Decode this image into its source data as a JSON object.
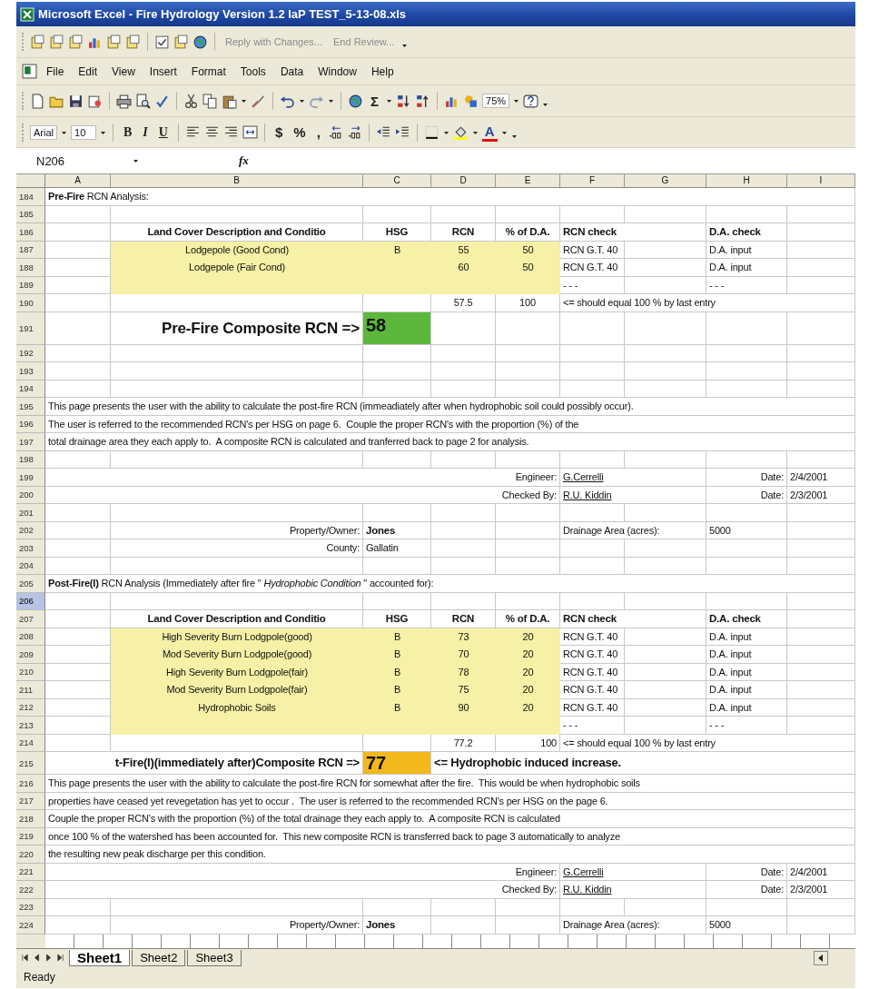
{
  "window": {
    "title": "Microsoft Excel - Fire Hydrology Version 1.2 IaP TEST_5-13-08.xls"
  },
  "review_toolbar": {
    "items": [
      {
        "kind": "review"
      },
      {
        "kind": "review"
      },
      {
        "kind": "review"
      },
      {
        "kind": "chart"
      },
      {
        "kind": "review"
      },
      {
        "kind": "review"
      },
      {
        "kind": "separator"
      },
      {
        "kind": "check"
      },
      {
        "kind": "review"
      },
      {
        "kind": "globe"
      },
      {
        "kind": "separator"
      }
    ],
    "reply": "Reply with Changes...",
    "end_review": "End Review..."
  },
  "menu": [
    {
      "label": "File"
    },
    {
      "label": "Edit"
    },
    {
      "label": "View"
    },
    {
      "label": "Insert"
    },
    {
      "label": "Format"
    },
    {
      "label": "Tools"
    },
    {
      "label": "Data"
    },
    {
      "label": "Window"
    },
    {
      "label": "Help"
    }
  ],
  "standard_toolbar": [
    {
      "kind": "document"
    },
    {
      "kind": "folder"
    },
    {
      "kind": "save"
    },
    {
      "kind": "permission"
    },
    {
      "kind": "separator"
    },
    {
      "kind": "print"
    },
    {
      "kind": "preview"
    },
    {
      "kind": "spell"
    },
    {
      "kind": "separator"
    },
    {
      "kind": "cut"
    },
    {
      "kind": "copy"
    },
    {
      "kind": "paste"
    },
    {
      "kind": "dropdown"
    },
    {
      "kind": "brush"
    },
    {
      "kind": "separator"
    },
    {
      "kind": "undo"
    },
    {
      "kind": "dropdown"
    },
    {
      "kind": "redo"
    },
    {
      "kind": "dropdown"
    },
    {
      "kind": "separator"
    },
    {
      "kind": "globe"
    },
    {
      "kind": "symbol",
      "label": "Σ"
    },
    {
      "kind": "dropdown"
    },
    {
      "kind": "sort-asc"
    },
    {
      "kind": "sort-desc"
    },
    {
      "kind": "separator"
    },
    {
      "kind": "chart"
    },
    {
      "kind": "drawing"
    },
    {
      "kind": "combo",
      "value": "75%"
    },
    {
      "kind": "help"
    },
    {
      "kind": "overflow"
    }
  ],
  "formatting_toolbar": [
    {
      "kind": "combo",
      "value": "Arial"
    },
    {
      "kind": "combo",
      "value": "10"
    },
    {
      "kind": "separator"
    },
    {
      "kind": "bold",
      "label": "B"
    },
    {
      "kind": "italic",
      "label": "I"
    },
    {
      "kind": "underline",
      "label": "U"
    },
    {
      "kind": "separator"
    },
    {
      "kind": "align-left"
    },
    {
      "kind": "align-center"
    },
    {
      "kind": "align-right"
    },
    {
      "kind": "merge"
    },
    {
      "kind": "separator"
    },
    {
      "kind": "symbol",
      "label": "$"
    },
    {
      "kind": "symbol",
      "label": "%"
    },
    {
      "kind": "symbol",
      "label": ","
    },
    {
      "kind": "decimal-more"
    },
    {
      "kind": "decimal-less"
    },
    {
      "kind": "separator"
    },
    {
      "kind": "indent-less"
    },
    {
      "kind": "indent-more"
    },
    {
      "kind": "separator"
    },
    {
      "kind": "borders"
    },
    {
      "kind": "dropdown"
    },
    {
      "kind": "fill-color"
    },
    {
      "kind": "dropdown"
    },
    {
      "kind": "font-color",
      "label": "A"
    },
    {
      "kind": "dropdown"
    },
    {
      "kind": "overflow"
    }
  ],
  "formula_bar": {
    "name_box": "N206",
    "function_label": "fx"
  },
  "columns": [
    "A",
    "B",
    "C",
    "D",
    "E",
    "F",
    "G",
    "H",
    "I"
  ],
  "rows": [
    {
      "number": "184",
      "selected": false,
      "cells": {
        "A": {
          "text": "**Pre-Fire** RCN Analysis:",
          "kind": "rich",
          "overflow": true
        }
      }
    },
    {
      "number": "185",
      "selected": false
    },
    {
      "number": "186",
      "selected": false,
      "cells": {
        "B": {
          "text": "Land Cover Description and Conditio",
          "kind": "bold",
          "centered": true
        },
        "C": {
          "text": "HSG",
          "kind": "bold",
          "centered": true
        },
        "D": {
          "text": "RCN",
          "kind": "bold",
          "centered": true
        },
        "E": {
          "text": "% of D.A.",
          "kind": "bold",
          "centered": true
        },
        "F": {
          "text": "RCN check",
          "kind": "bold",
          "overflow": true
        },
        "H": {
          "text": "D.A. check",
          "kind": "bold"
        }
      }
    },
    {
      "number": "187",
      "selected": false,
      "cells": {
        "B": {
          "text": "Lodgepole (Good Cond)",
          "kind": "plain",
          "centered": true,
          "color": "#f6f1a6"
        },
        "C": {
          "text": "B",
          "kind": "plain",
          "centered": true,
          "color": "#f6f1a6"
        },
        "D": {
          "text": "55",
          "kind": "plain",
          "centered": true,
          "color": "#f6f1a6"
        },
        "E": {
          "text": "50",
          "kind": "plain",
          "centered": true,
          "color": "#f6f1a6"
        },
        "F": {
          "text": "RCN G.T. 40",
          "kind": "plain"
        },
        "H": {
          "text": "D.A. input",
          "kind": "plain"
        }
      }
    },
    {
      "number": "188",
      "selected": false,
      "cells": {
        "B": {
          "text": "Lodgepole (Fair Cond)",
          "kind": "plain",
          "centered": true,
          "color": "#f6f1a6"
        },
        "C": {
          "color": "#f6f1a6"
        },
        "D": {
          "text": "60",
          "kind": "plain",
          "centered": true,
          "color": "#f6f1a6"
        },
        "E": {
          "text": "50",
          "kind": "plain",
          "centered": true,
          "color": "#f6f1a6"
        },
        "F": {
          "text": "RCN G.T. 40",
          "kind": "plain"
        },
        "H": {
          "text": "D.A. input",
          "kind": "plain"
        }
      }
    },
    {
      "number": "189",
      "selected": false,
      "cells": {
        "B": {
          "color": "#f6f1a6"
        },
        "C": {
          "color": "#f6f1a6"
        },
        "D": {
          "color": "#f6f1a6"
        },
        "E": {
          "color": "#f6f1a6"
        },
        "F": {
          "text": "- - -",
          "kind": "plain"
        },
        "H": {
          "text": "- - -",
          "kind": "plain"
        }
      }
    },
    {
      "number": "190",
      "selected": false,
      "cells": {
        "D": {
          "text": "57.5",
          "kind": "plain",
          "centered": true
        },
        "E": {
          "text": "100",
          "kind": "plain",
          "centered": true
        },
        "F": {
          "text": "<= should equal 100 % by last entry",
          "kind": "plain",
          "overflow": true
        }
      }
    },
    {
      "number": "191",
      "selected": false,
      "cells": {
        "B": {
          "text": "Pre-Fire Composite RCN =>",
          "kind": "title",
          "right_aligned": true
        },
        "C": {
          "text": "58",
          "kind": "result",
          "color": "#5cb83c"
        }
      }
    },
    {
      "number": "192",
      "selected": false
    },
    {
      "number": "193",
      "selected": false
    },
    {
      "number": "194",
      "selected": false
    },
    {
      "number": "195",
      "selected": false,
      "cells": {
        "A": {
          "text": "This page presents the user with the ability to calculate the post-fire RCN (immeadiately after when hydrophobic soil could possibly occur).",
          "kind": "plain",
          "overflow": true
        }
      }
    },
    {
      "number": "196",
      "selected": false,
      "cells": {
        "A": {
          "text": "The user is referred to the recommended RCN's per HSG on page 6.  Couple the proper RCN's with the proportion (%) of the",
          "kind": "plain",
          "overflow": true
        }
      }
    },
    {
      "number": "197",
      "selected": false,
      "cells": {
        "A": {
          "text": "total drainage area they each apply to.  A composite RCN is calculated and tranferred back to page 2 for analysis.",
          "kind": "plain",
          "overflow": true
        }
      }
    },
    {
      "number": "198",
      "selected": false
    },
    {
      "number": "199",
      "selected": false,
      "cells": {
        "E": {
          "text": "Engineer:",
          "kind": "plain",
          "right_aligned": true,
          "overflow": true
        },
        "F": {
          "text": "G.Cerrelli",
          "kind": "underline",
          "overflow": true
        },
        "H": {
          "text": "Date:",
          "kind": "plain",
          "right_aligned": true
        },
        "I": {
          "text": "2/4/2001",
          "kind": "plain"
        }
      }
    },
    {
      "number": "200",
      "selected": false,
      "cells": {
        "E": {
          "text": "Checked By:",
          "kind": "plain",
          "right_aligned": true,
          "overflow": true
        },
        "F": {
          "text": "R.U. Kiddin",
          "kind": "underline",
          "overflow": true
        },
        "H": {
          "text": "Date:",
          "kind": "plain",
          "right_aligned": true
        },
        "I": {
          "text": "2/3/2001",
          "kind": "plain"
        }
      }
    },
    {
      "number": "201",
      "selected": false
    },
    {
      "number": "202",
      "selected": false,
      "cells": {
        "B": {
          "text": "Property/Owner:",
          "kind": "plain",
          "right_aligned": true
        },
        "C": {
          "text": "Jones",
          "kind": "bold"
        },
        "F": {
          "text": "Drainage Area (acres):",
          "kind": "plain",
          "overflow": true
        },
        "H": {
          "text": "5000",
          "kind": "plain"
        }
      }
    },
    {
      "number": "203",
      "selected": false,
      "cells": {
        "B": {
          "text": "County:",
          "kind": "plain",
          "right_aligned": true
        },
        "C": {
          "text": "Gallatin",
          "kind": "plain"
        }
      }
    },
    {
      "number": "204",
      "selected": false
    },
    {
      "number": "205",
      "selected": false,
      "cells": {
        "A": {
          "text": "**Post-Fire(I)** RCN Analysis (Immediately after fire \" *Hydrophobic Condition* \" accounted for):",
          "kind": "rich",
          "overflow": true
        }
      }
    },
    {
      "number": "206",
      "selected": true
    },
    {
      "number": "207",
      "selected": false,
      "cells": {
        "B": {
          "text": "Land Cover Description and Conditio",
          "kind": "bold",
          "centered": true
        },
        "C": {
          "text": "HSG",
          "kind": "bold",
          "centered": true
        },
        "D": {
          "text": "RCN",
          "kind": "bold",
          "centered": true
        },
        "E": {
          "text": "% of D.A.",
          "kind": "bold",
          "centered": true
        },
        "F": {
          "text": "RCN check",
          "kind": "bold",
          "overflow": true
        },
        "H": {
          "text": "D.A. check",
          "kind": "bold"
        }
      }
    },
    {
      "number": "208",
      "selected": false,
      "cells": {
        "B": {
          "text": "High Severity Burn Lodgpole(good)",
          "kind": "plain",
          "centered": true,
          "color": "#f6f1a6"
        },
        "C": {
          "text": "B",
          "kind": "plain",
          "centered": true,
          "color": "#f6f1a6"
        },
        "D": {
          "text": "73",
          "kind": "plain",
          "centered": true,
          "color": "#f6f1a6"
        },
        "E": {
          "text": "20",
          "kind": "plain",
          "centered": true,
          "color": "#f6f1a6"
        },
        "F": {
          "text": "RCN G.T. 40",
          "kind": "plain"
        },
        "H": {
          "text": "D.A. input",
          "kind": "plain"
        }
      }
    },
    {
      "number": "209",
      "selected": false,
      "cells": {
        "B": {
          "text": "Mod Severity Burn Lodgpole(good)",
          "kind": "plain",
          "centered": true,
          "color": "#f6f1a6"
        },
        "C": {
          "text": "B",
          "kind": "plain",
          "centered": true,
          "color": "#f6f1a6"
        },
        "D": {
          "text": "70",
          "kind": "plain",
          "centered": true,
          "color": "#f6f1a6"
        },
        "E": {
          "text": "20",
          "kind": "plain",
          "centered": true,
          "color": "#f6f1a6"
        },
        "F": {
          "text": "RCN G.T. 40",
          "kind": "plain"
        },
        "H": {
          "text": "D.A. input",
          "kind": "plain"
        }
      }
    },
    {
      "number": "210",
      "selected": false,
      "cells": {
        "B": {
          "text": "High Severity Burn Lodgpole(fair)",
          "kind": "plain",
          "centered": true,
          "color": "#f6f1a6"
        },
        "C": {
          "text": "B",
          "kind": "plain",
          "centered": true,
          "color": "#f6f1a6"
        },
        "D": {
          "text": "78",
          "kind": "plain",
          "centered": true,
          "color": "#f6f1a6"
        },
        "E": {
          "text": "20",
          "kind": "plain",
          "centered": true,
          "color": "#f6f1a6"
        },
        "F": {
          "text": "RCN G.T. 40",
          "kind": "plain"
        },
        "H": {
          "text": "D.A. input",
          "kind": "plain"
        }
      }
    },
    {
      "number": "211",
      "selected": false,
      "cells": {
        "B": {
          "text": "Mod Severity Burn Lodgpole(fair)",
          "kind": "plain",
          "centered": true,
          "color": "#f6f1a6"
        },
        "C": {
          "text": "B",
          "kind": "plain",
          "centered": true,
          "color": "#f6f1a6"
        },
        "D": {
          "text": "75",
          "kind": "plain",
          "centered": true,
          "color": "#f6f1a6"
        },
        "E": {
          "text": "20",
          "kind": "plain",
          "centered": true,
          "color": "#f6f1a6"
        },
        "F": {
          "text": "RCN G.T. 40",
          "kind": "plain"
        },
        "H": {
          "text": "D.A. input",
          "kind": "plain"
        }
      }
    },
    {
      "number": "212",
      "selected": false,
      "cells": {
        "B": {
          "text": "Hydrophobic Soils",
          "kind": "plain",
          "centered": true,
          "color": "#f6f1a6"
        },
        "C": {
          "text": "B",
          "kind": "plain",
          "centered": true,
          "color": "#f6f1a6"
        },
        "D": {
          "text": "90",
          "kind": "plain",
          "centered": true,
          "color": "#f6f1a6"
        },
        "E": {
          "text": "20",
          "kind": "plain",
          "centered": true,
          "color": "#f6f1a6"
        },
        "F": {
          "text": "RCN G.T. 40",
          "kind": "plain"
        },
        "H": {
          "text": "D.A. input",
          "kind": "plain"
        }
      }
    },
    {
      "number": "213",
      "selected": false,
      "cells": {
        "B": {
          "color": "#f6f1a6"
        },
        "C": {
          "color": "#f6f1a6"
        },
        "D": {
          "color": "#f6f1a6"
        },
        "E": {
          "color": "#f6f1a6"
        },
        "F": {
          "text": "- - -",
          "kind": "plain"
        },
        "H": {
          "text": "- - -",
          "kind": "plain"
        }
      }
    },
    {
      "number": "214",
      "selected": false,
      "cells": {
        "D": {
          "text": "77.2",
          "kind": "plain",
          "centered": true
        },
        "E": {
          "text": "100",
          "kind": "plain",
          "right_aligned": true
        },
        "F": {
          "text": "<= should equal 100 % by last entry",
          "kind": "plain",
          "overflow": true
        }
      }
    },
    {
      "number": "215",
      "selected": false,
      "cells": {
        "B": {
          "text": "t-Fire(I)(immediately after)Composite RCN =>",
          "kind": "heading",
          "right_aligned": true,
          "overflow": true
        },
        "C": {
          "text": "77",
          "kind": "result",
          "color": "#f2b81c"
        },
        "D": {
          "text": "<= Hydrophobic induced increase.",
          "kind": "heading",
          "overflow": true
        }
      }
    },
    {
      "number": "216",
      "selected": false,
      "cells": {
        "A": {
          "text": "This page presents the user with the ability to calculate the post-fire RCN for somewhat after the fire.  This would be when hydrophobic soils",
          "kind": "plain",
          "overflow": true
        }
      }
    },
    {
      "number": "217",
      "selected": false,
      "cells": {
        "A": {
          "text": "properties have ceased yet revegetation has yet to occur .  The user is referred to the recommended RCN's per HSG on the page 6.",
          "kind": "plain",
          "overflow": true
        }
      }
    },
    {
      "number": "218",
      "selected": false,
      "cells": {
        "A": {
          "text": "Couple the proper RCN's with the proportion (%) of the total drainage they each apply to.  A composite RCN is calculated",
          "kind": "plain",
          "overflow": true
        }
      }
    },
    {
      "number": "219",
      "selected": false,
      "cells": {
        "A": {
          "text": "once 100 % of the watershed has been accounted for.  This new composite RCN is transferred back to page 3 automatically to analyze",
          "kind": "plain",
          "overflow": true
        }
      }
    },
    {
      "number": "220",
      "selected": false,
      "cells": {
        "A": {
          "text": "the resulting new peak discharge per this condition.",
          "kind": "plain",
          "overflow": true
        }
      }
    },
    {
      "number": "221",
      "selected": false,
      "cells": {
        "E": {
          "text": "Engineer:",
          "kind": "plain",
          "right_aligned": true,
          "overflow": true
        },
        "F": {
          "text": "G.Cerrelli",
          "kind": "underline",
          "overflow": true
        },
        "H": {
          "text": "Date:",
          "kind": "plain",
          "right_aligned": true
        },
        "I": {
          "text": "2/4/2001",
          "kind": "plain"
        }
      }
    },
    {
      "number": "222",
      "selected": false,
      "cells": {
        "E": {
          "text": "Checked By:",
          "kind": "plain",
          "right_aligned": true,
          "overflow": true
        },
        "F": {
          "text": "R.U. Kiddin",
          "kind": "underline",
          "overflow": true
        },
        "H": {
          "text": "Date:",
          "kind": "plain",
          "right_aligned": true
        },
        "I": {
          "text": "2/3/2001",
          "kind": "plain"
        }
      }
    },
    {
      "number": "223",
      "selected": false
    },
    {
      "number": "224",
      "selected": false,
      "cells": {
        "B": {
          "text": "Property/Owner:",
          "kind": "plain",
          "right_aligned": true
        },
        "C": {
          "text": "Jones",
          "kind": "bold"
        },
        "F": {
          "text": "Drainage Area (acres):",
          "kind": "plain",
          "overflow": true
        },
        "H": {
          "text": "5000",
          "kind": "plain"
        }
      }
    }
  ],
  "sheet_tabs": [
    {
      "label": "Sheet1",
      "selected": true
    },
    {
      "label": "Sheet2",
      "selected": false
    },
    {
      "label": "Sheet3",
      "selected": false
    }
  ],
  "status_bar": {
    "text": "Ready"
  }
}
